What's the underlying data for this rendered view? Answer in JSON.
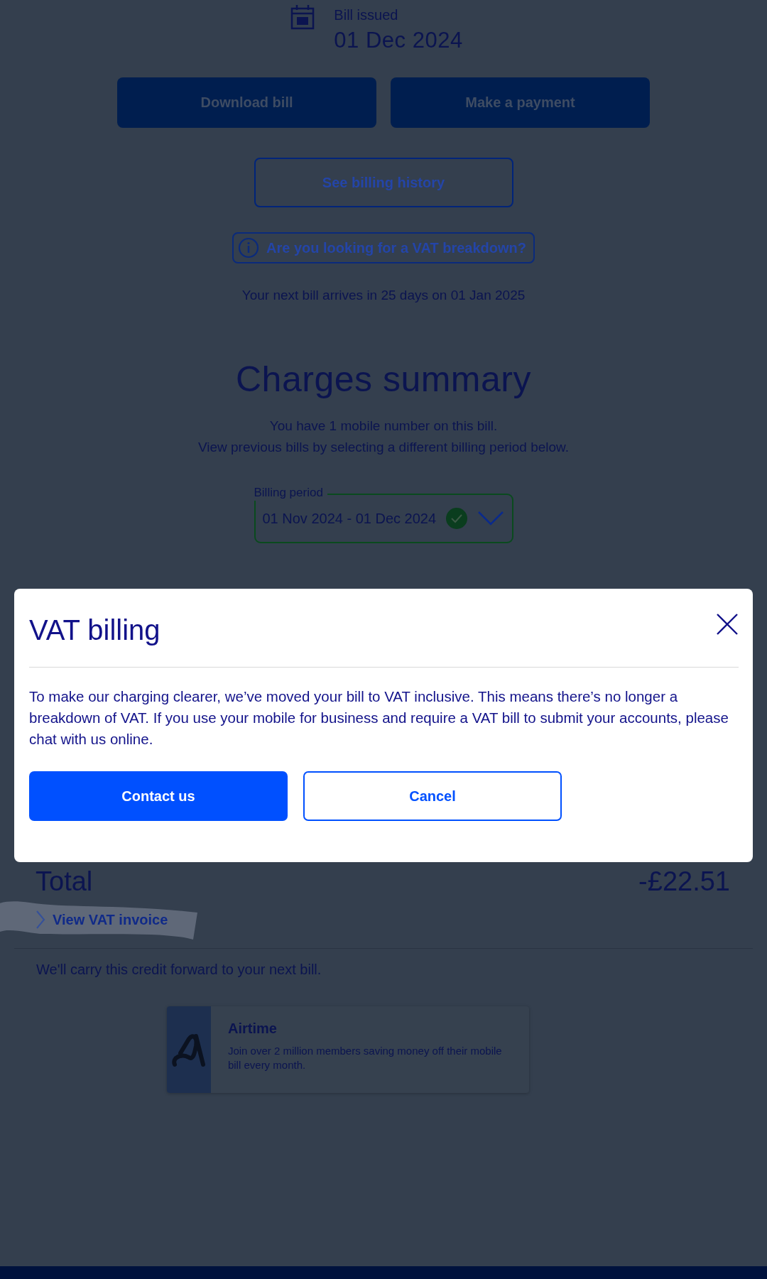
{
  "bill_issued": {
    "label": "Bill issued",
    "date": "01 Dec 2024"
  },
  "actions": [
    {
      "label": "Download bill",
      "kind": "filled"
    },
    {
      "label": "Make a payment",
      "kind": "filled"
    }
  ],
  "billing_history_button": "See billing history",
  "vat_breakdown_link": "Are you looking for a VAT breakdown?",
  "next_bill": "Your next bill arrives in 25 days on 01 Jan 2025",
  "charges_summary": {
    "title": "Charges summary",
    "lines": [
      "You have 1 mobile number on this bill.",
      "View previous bills by selecting a different billing period below."
    ],
    "billing_period": {
      "label": "Billing period",
      "value": "01 Nov 2024 - 01 Dec 2024",
      "valid": true
    }
  },
  "total": {
    "label": "Total",
    "amount": "-£22.51"
  },
  "vat_invoice_link": {
    "label": "View VAT invoice",
    "highlighted": true
  },
  "credit_note": "We'll carry this credit forward to your next bill.",
  "promo": {
    "title": "Airtime",
    "text": "Join over 2 million members saving money off their mobile bill every month."
  },
  "modal": {
    "title": "VAT billing",
    "body": "To make our charging clearer, we’ve moved your bill to VAT inclusive. This means there’s no longer a breakdown of VAT. If you use your mobile for business and require a VAT bill to submit your accounts, please chat with us online.",
    "buttons": [
      {
        "label": "Contact us",
        "kind": "primary"
      },
      {
        "label": "Cancel",
        "kind": "secondary"
      }
    ]
  }
}
